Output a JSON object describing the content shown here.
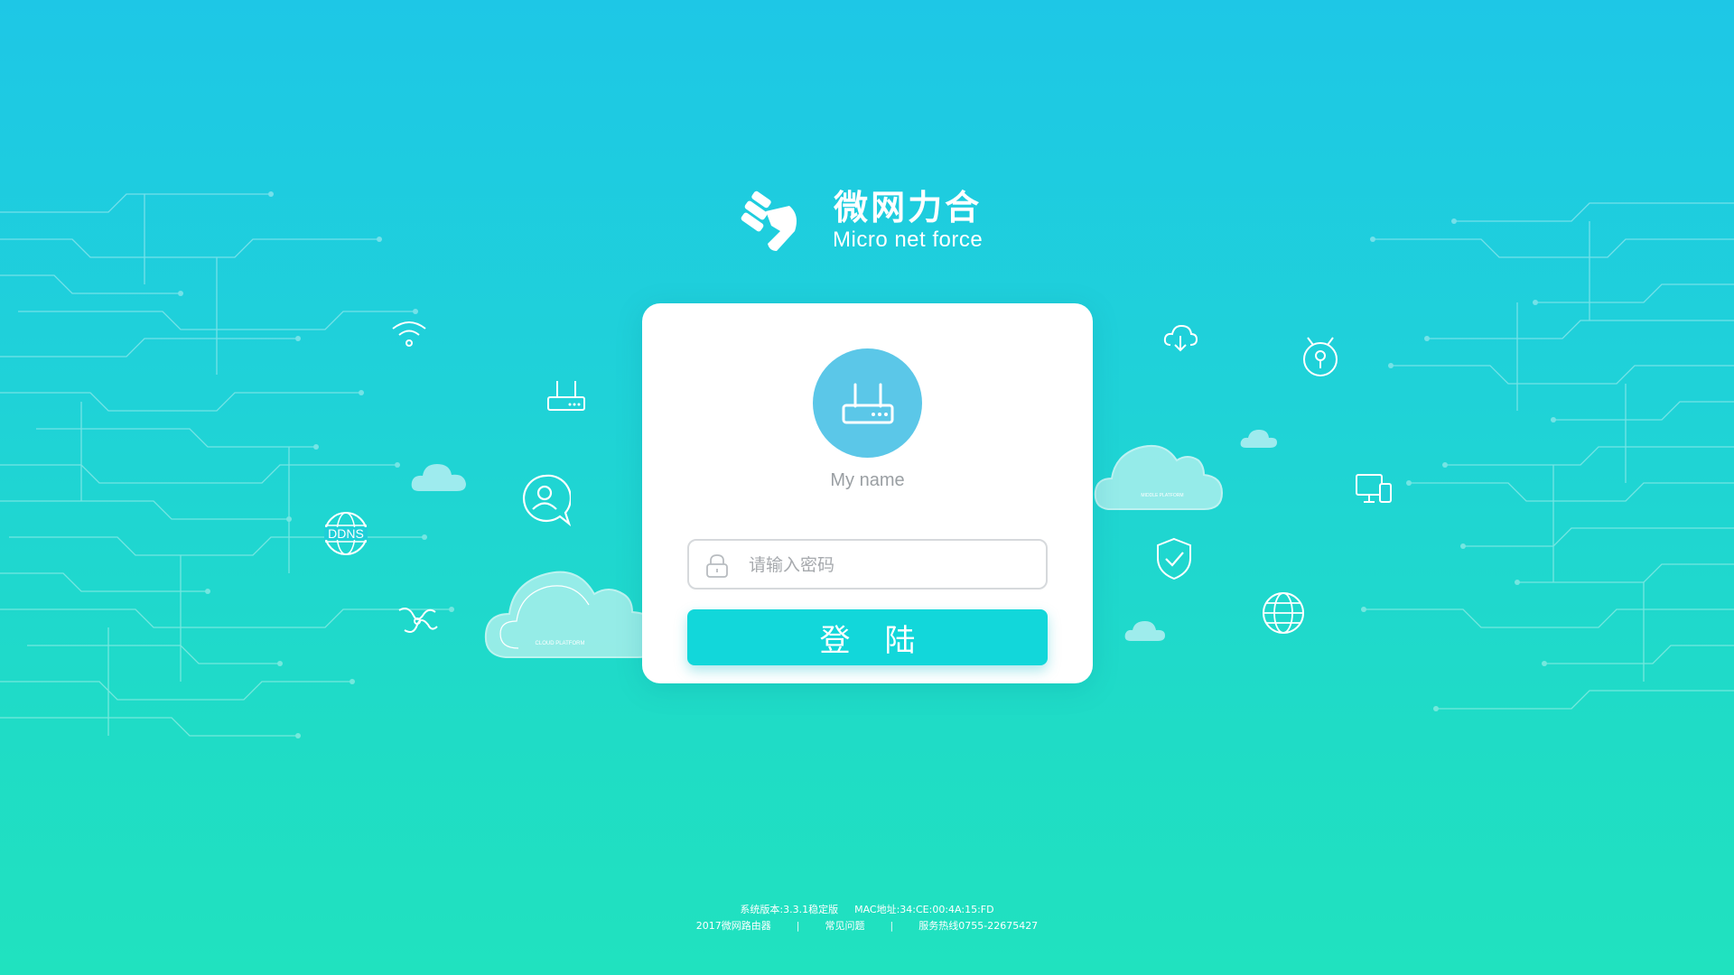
{
  "brand": {
    "name_cn": "微网力合",
    "name_en": "Micro net force",
    "logo_icon": "hand-logo-icon"
  },
  "login": {
    "avatar_icon": "router-icon",
    "username": "My name",
    "password_placeholder": "请输入密码",
    "password_value": "",
    "lock_icon": "lock-icon",
    "submit_label": "登陆"
  },
  "decorations": {
    "cloud_left_label": "CLOUD PLATFORM",
    "cloud_right_label": "MIDDLE PLATFORM",
    "ddns_label": "DDNS",
    "icons": [
      "wifi-icon",
      "router-icon",
      "cloud-icon",
      "user-chat-icon",
      "ddns-globe-icon",
      "link-icon",
      "cloud-download-icon",
      "location-pin-icon",
      "devices-icon",
      "shield-check-icon",
      "globe-icon"
    ]
  },
  "footer": {
    "version": "系统版本:3.3.1稳定版",
    "mac": "MAC地址:34:CE:00:4A:15:FD",
    "copyright": "2017微网路由器",
    "faq_link": "常见问题",
    "hotline": "服务热线0755-22675427",
    "separator": "|"
  },
  "colors": {
    "background_top": "#1ec7e6",
    "background_bottom": "#20e2bf",
    "button": "#12d7da",
    "avatar": "#5bc7e8"
  }
}
